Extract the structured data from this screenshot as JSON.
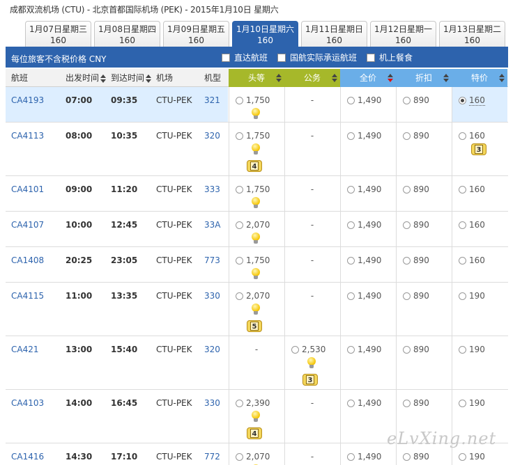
{
  "route_title": "成都双流机场 (CTU) - 北京首都国际机场 (PEK) - 2015年1月10日 星期六",
  "date_tabs": [
    {
      "date": "1月07日星期三",
      "price": "160",
      "active": false
    },
    {
      "date": "1月08日星期四",
      "price": "160",
      "active": false
    },
    {
      "date": "1月09日星期五",
      "price": "160",
      "active": false
    },
    {
      "date": "1月10日星期六",
      "price": "160",
      "active": true
    },
    {
      "date": "1月11日星期日",
      "price": "160",
      "active": false
    },
    {
      "date": "1月12日星期一",
      "price": "160",
      "active": false
    },
    {
      "date": "1月13日星期二",
      "price": "160",
      "active": false
    }
  ],
  "info_bar": {
    "note": "每位旅客不含税价格 CNY",
    "filters": [
      "直达航班",
      "国航实际承运航班",
      "机上餐食"
    ]
  },
  "columns": {
    "flight": "航班",
    "depart": "出发时间",
    "arrive": "到达时间",
    "airport": "机场",
    "aircraft": "机型"
  },
  "fare_headers": [
    {
      "label": "头等",
      "color": "#a6b82a"
    },
    {
      "label": "公务",
      "color": "#a6b82a"
    },
    {
      "label": "全价",
      "color": "#6aaee8"
    },
    {
      "label": "折扣",
      "color": "#6aaee8"
    },
    {
      "label": "特价",
      "color": "#6aaee8"
    }
  ],
  "flights": [
    {
      "no": "CA4193",
      "dep": "07:00",
      "arr": "09:35",
      "airport": "CTU-PEK",
      "type": "321",
      "selected": true,
      "fares": [
        {
          "price": "1,750",
          "bulb": true,
          "badge": ""
        },
        {
          "price": "-"
        },
        {
          "price": "1,490"
        },
        {
          "price": "890"
        },
        {
          "price": "160",
          "checked": true
        }
      ]
    },
    {
      "no": "CA4113",
      "dep": "08:00",
      "arr": "10:35",
      "airport": "CTU-PEK",
      "type": "320",
      "fares": [
        {
          "price": "1,750",
          "bulb": true,
          "badge": "4"
        },
        {
          "price": "-"
        },
        {
          "price": "1,490"
        },
        {
          "price": "890"
        },
        {
          "price": "160",
          "badge": "3"
        }
      ]
    },
    {
      "no": "CA4101",
      "dep": "09:00",
      "arr": "11:20",
      "airport": "CTU-PEK",
      "type": "333",
      "fares": [
        {
          "price": "1,750",
          "bulb": true
        },
        {
          "price": "-"
        },
        {
          "price": "1,490"
        },
        {
          "price": "890"
        },
        {
          "price": "160"
        }
      ]
    },
    {
      "no": "CA4107",
      "dep": "10:00",
      "arr": "12:45",
      "airport": "CTU-PEK",
      "type": "33A",
      "fares": [
        {
          "price": "2,070",
          "bulb": true
        },
        {
          "price": "-"
        },
        {
          "price": "1,490"
        },
        {
          "price": "890"
        },
        {
          "price": "160"
        }
      ]
    },
    {
      "no": "CA1408",
      "dep": "20:25",
      "arr": "23:05",
      "airport": "CTU-PEK",
      "type": "773",
      "fares": [
        {
          "price": "1,750",
          "bulb": true
        },
        {
          "price": "-"
        },
        {
          "price": "1,490"
        },
        {
          "price": "890"
        },
        {
          "price": "160"
        }
      ]
    },
    {
      "no": "CA4115",
      "dep": "11:00",
      "arr": "13:35",
      "airport": "CTU-PEK",
      "type": "330",
      "fares": [
        {
          "price": "2,070",
          "bulb": true,
          "badge": "5"
        },
        {
          "price": "-"
        },
        {
          "price": "1,490"
        },
        {
          "price": "890"
        },
        {
          "price": "190"
        }
      ]
    },
    {
      "no": "CA421",
      "dep": "13:00",
      "arr": "15:40",
      "airport": "CTU-PEK",
      "type": "320",
      "fares": [
        {
          "price": "-"
        },
        {
          "price": "2,530",
          "bulb": true,
          "badge": "3"
        },
        {
          "price": "1,490"
        },
        {
          "price": "890"
        },
        {
          "price": "190"
        }
      ]
    },
    {
      "no": "CA4103",
      "dep": "14:00",
      "arr": "16:45",
      "airport": "CTU-PEK",
      "type": "330",
      "fares": [
        {
          "price": "2,390",
          "bulb": true,
          "badge": "4"
        },
        {
          "price": "-"
        },
        {
          "price": "1,490"
        },
        {
          "price": "890"
        },
        {
          "price": "190"
        }
      ]
    },
    {
      "no": "CA1416",
      "dep": "14:30",
      "arr": "17:10",
      "airport": "CTU-PEK",
      "type": "772",
      "fares": [
        {
          "price": "2,070",
          "bulb": true
        },
        {
          "price": "-"
        },
        {
          "price": "1,490"
        },
        {
          "price": "890"
        },
        {
          "price": "190"
        }
      ]
    }
  ],
  "watermark": "eLvXing.net"
}
